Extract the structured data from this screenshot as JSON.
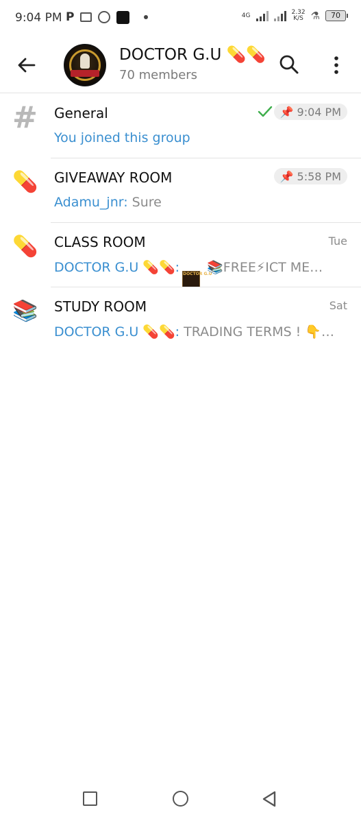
{
  "status_bar": {
    "time": "9:04 PM",
    "network": "4G",
    "speed_value": "2.32",
    "speed_unit": "K/S",
    "battery": "70"
  },
  "header": {
    "title": "DOCTOR G.U 💊💊",
    "subtitle": "70 members"
  },
  "topics": [
    {
      "name": "General",
      "icon": "hash-icon",
      "time": "9:04 PM",
      "pinned": true,
      "read": true,
      "message": "You joined this group"
    },
    {
      "name": "GIVEAWAY ROOM",
      "icon": "💊",
      "time": "5:58 PM",
      "pinned": true,
      "sender": "Adamu_jnr:",
      "message": " Sure"
    },
    {
      "name": "CLASS ROOM",
      "icon": "💊",
      "time": "Tue",
      "sender": "DOCTOR G.U 💊💊:",
      "thumb_text": "DOCTOR G.U",
      "message": " 📚FREE⚡ICT ME…"
    },
    {
      "name": "STUDY ROOM",
      "icon": "📚",
      "time": "Sat",
      "sender": "DOCTOR G.U 💊💊:",
      "message": " TRADING TERMS ! 👇…"
    }
  ]
}
